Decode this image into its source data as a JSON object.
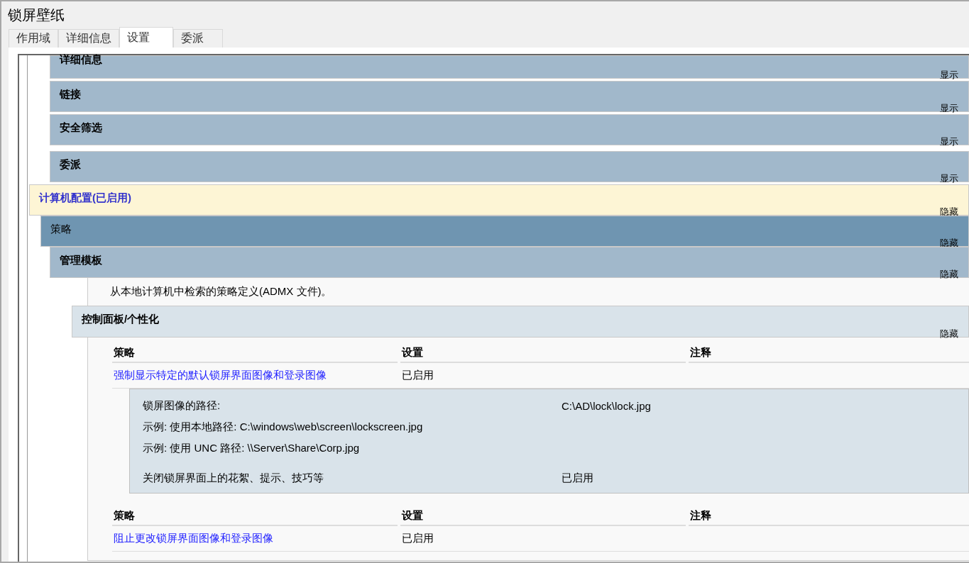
{
  "window": {
    "title": "锁屏壁纸"
  },
  "tabs": [
    {
      "label": "作用域",
      "selected": false
    },
    {
      "label": "详细信息",
      "selected": false
    },
    {
      "label": "设置",
      "selected": true
    },
    {
      "label": "委派",
      "selected": false
    }
  ],
  "blocks": [
    {
      "kind": "heading",
      "title": "详细信息",
      "toggle": "显示"
    },
    {
      "kind": "heading",
      "title": "链接",
      "toggle": "显示"
    },
    {
      "kind": "heading",
      "title": "安全筛选",
      "toggle": "显示"
    },
    {
      "kind": "heading",
      "title": "委派",
      "toggle": "显示"
    },
    {
      "kind": "config",
      "title": "计算机配置(已启用)",
      "toggle": "隐藏"
    },
    {
      "kind": "group",
      "title": "策略",
      "toggle": "隐藏"
    },
    {
      "kind": "heading",
      "title": "管理模板",
      "toggle": "隐藏"
    },
    {
      "kind": "note",
      "title": "从本地计算机中检索的策略定义(ADMX 文件)。"
    },
    {
      "kind": "category",
      "title": "控制面板/个性化",
      "toggle": "隐藏"
    }
  ],
  "policy_tables": [
    {
      "columns": [
        "策略",
        "设置",
        "注释"
      ],
      "policy": "强制显示特定的默认锁屏界面图像和登录图像",
      "setting": "已启用",
      "details": [
        {
          "label": "锁屏图像的路径:",
          "value": "C:\\AD\\lock\\lock.jpg"
        },
        {
          "label": "示例: 使用本地路径: C:\\windows\\web\\screen\\lockscreen.jpg"
        },
        {
          "label": "示例: 使用 UNC 路径: \\\\Server\\Share\\Corp.jpg"
        },
        {
          "label": "关闭锁屏界面上的花絮、提示、技巧等",
          "value": "已启用",
          "gap": true
        }
      ]
    },
    {
      "columns": [
        "策略",
        "设置",
        "注释"
      ],
      "policy": "阻止更改锁屏界面图像和登录图像",
      "setting": "已启用"
    }
  ]
}
